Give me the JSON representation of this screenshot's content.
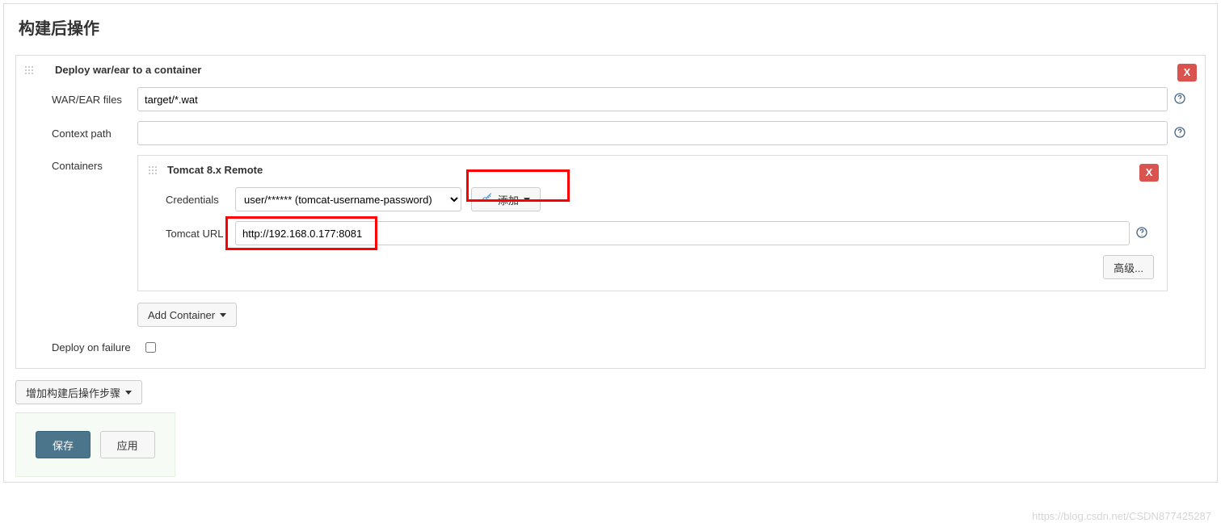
{
  "section": {
    "title": "构建后操作"
  },
  "deployBlock": {
    "title": "Deploy war/ear to a container",
    "closeLabel": "X",
    "warLabel": "WAR/EAR files",
    "warValue": "target/*.wat",
    "contextPathLabel": "Context path",
    "contextPathValue": "",
    "containersLabel": "Containers",
    "deployOnFailureLabel": "Deploy on failure"
  },
  "containerBlock": {
    "title": "Tomcat 8.x Remote",
    "closeLabel": "X",
    "credentialsLabel": "Credentials",
    "credentialsSelected": "user/****** (tomcat-username-password)",
    "addBtnLabel": "添加",
    "tomcatUrlLabel": "Tomcat URL",
    "tomcatUrlValue": "http://192.168.0.177:8081",
    "advancedBtnLabel": "高级..."
  },
  "addContainerBtn": {
    "label": "Add Container"
  },
  "addPostBuildStepBtn": {
    "label": "增加构建后操作步骤"
  },
  "saveBtn": {
    "label": "保存"
  },
  "applyBtn": {
    "label": "应用"
  },
  "watermark": "https://blog.csdn.net/CSDN877425287"
}
